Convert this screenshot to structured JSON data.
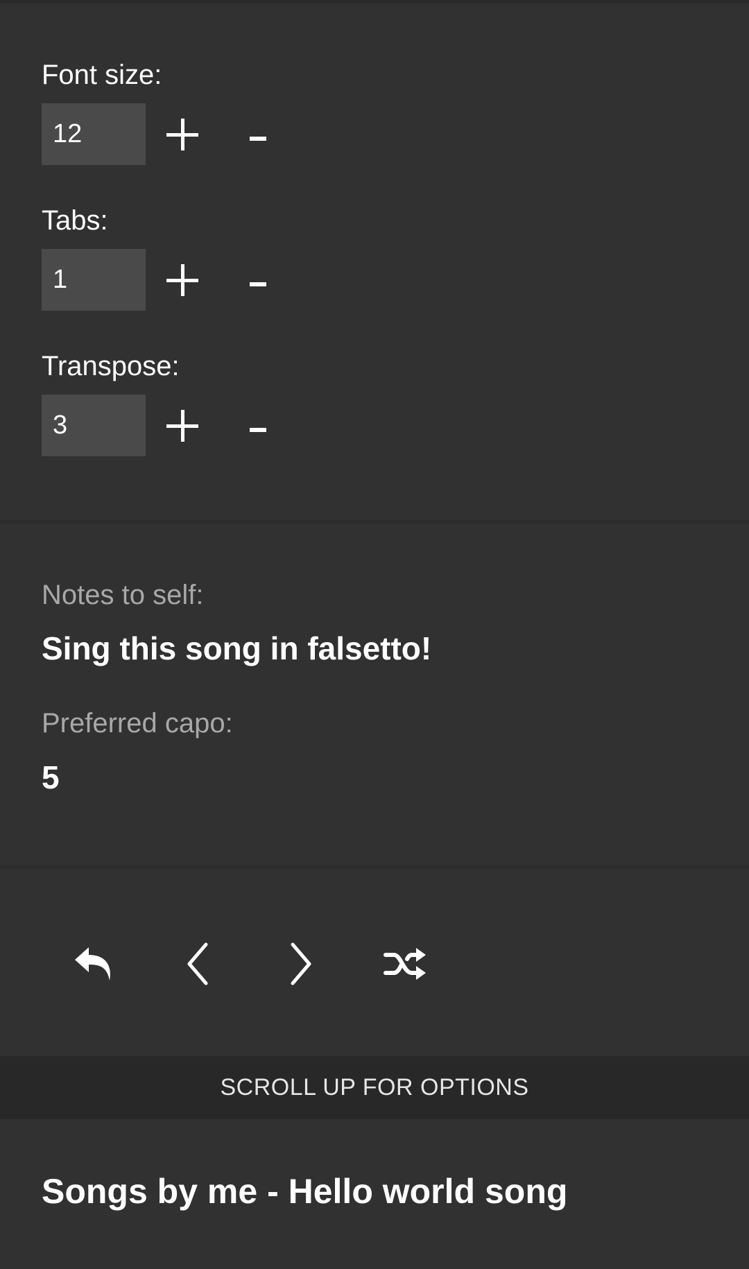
{
  "settings": {
    "font_size": {
      "label": "Font size:",
      "value": "12",
      "plus": "+",
      "minus": "-"
    },
    "tabs": {
      "label": "Tabs:",
      "value": "1",
      "plus": "+",
      "minus": "-"
    },
    "transpose": {
      "label": "Transpose:",
      "value": "3",
      "plus": "+",
      "minus": "-"
    }
  },
  "notes": {
    "notes_label": "Notes to self:",
    "notes_value": "Sing this song in falsetto!",
    "capo_label": "Preferred capo:",
    "capo_value": "5"
  },
  "nav": {
    "icons": [
      "reply-icon",
      "chevron-left-icon",
      "chevron-right-icon",
      "shuffle-icon"
    ]
  },
  "banner": {
    "text": "SCROLL UP FOR OPTIONS"
  },
  "song": {
    "title": "Songs by me - Hello world song"
  }
}
